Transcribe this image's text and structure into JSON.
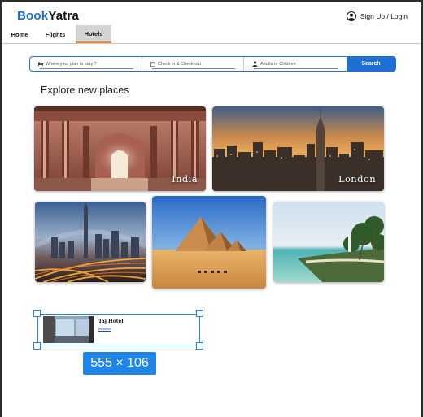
{
  "brand": {
    "name_part1": "Book",
    "name_part2": "Yatra"
  },
  "header": {
    "auth_label": "Sign Up / Login"
  },
  "nav": {
    "items": [
      {
        "label": "Home",
        "active": false
      },
      {
        "label": "Flights",
        "active": false
      },
      {
        "label": "Hotels",
        "active": true
      }
    ]
  },
  "search": {
    "where_placeholder": "Where your plan to stay ?",
    "dates_placeholder": "Check in & Check out",
    "guests_placeholder": "Adults or Children",
    "button_label": "Search"
  },
  "explore": {
    "title": "Explore new places",
    "places": [
      {
        "name": "India"
      },
      {
        "name": "London"
      },
      {
        "name": ""
      },
      {
        "name": ""
      },
      {
        "name": ""
      }
    ]
  },
  "selected_card": {
    "hotel_name": "Taj Hotel",
    "link_text": "Browse",
    "size_label": "555 × 106"
  },
  "colors": {
    "brand_blue": "#1f6fd1",
    "selection_blue": "#1f86e8",
    "active_tab_underline": "#f0892f",
    "active_tab_bg": "#d4d4d4"
  }
}
